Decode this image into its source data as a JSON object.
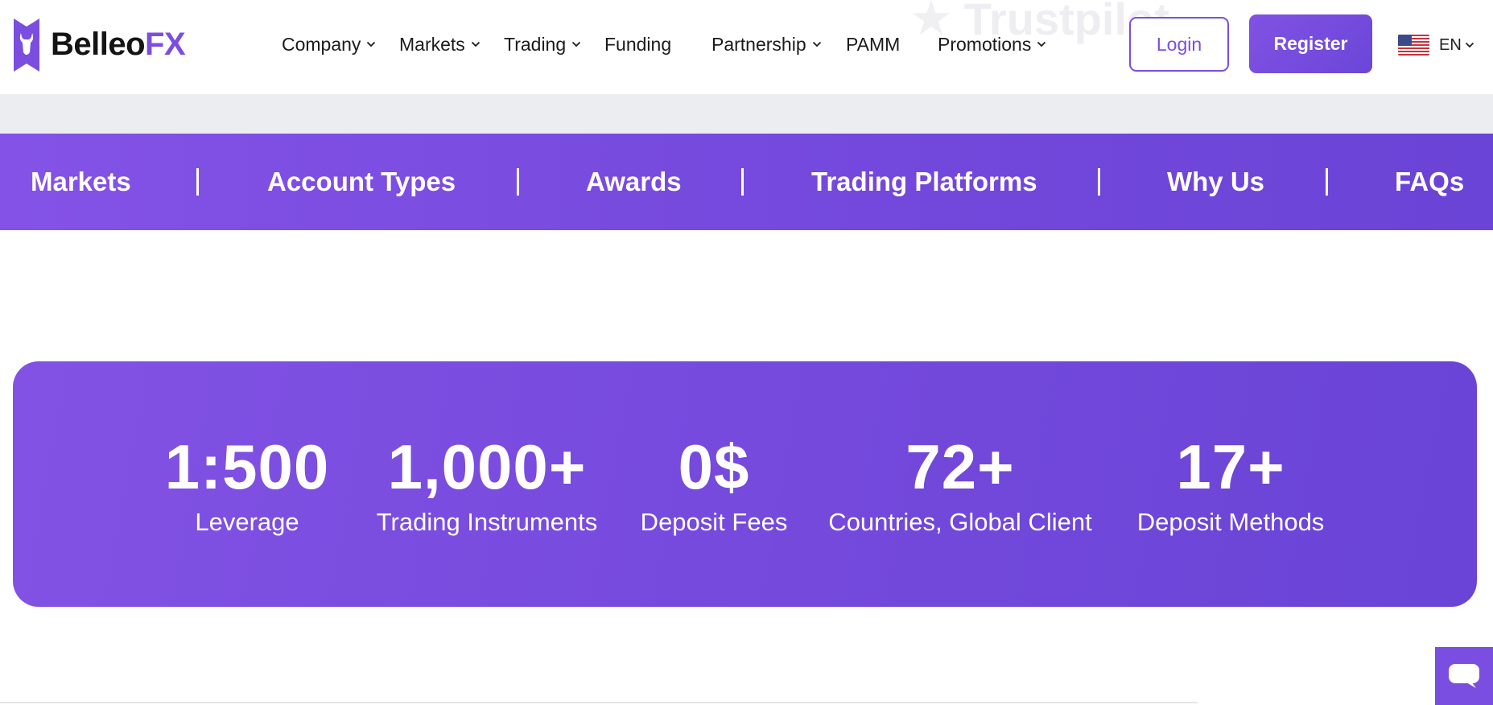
{
  "brand": {
    "name_main": "Belleo",
    "name_accent": "FX"
  },
  "nav": {
    "items": [
      {
        "label": "Company",
        "has_dropdown": true
      },
      {
        "label": "Markets",
        "has_dropdown": true
      },
      {
        "label": "Trading",
        "has_dropdown": true
      },
      {
        "label": "Funding",
        "has_dropdown": false
      },
      {
        "label": "Partnership",
        "has_dropdown": true
      },
      {
        "label": "PAMM",
        "has_dropdown": false
      },
      {
        "label": "Promotions",
        "has_dropdown": true
      }
    ]
  },
  "header": {
    "login_label": "Login",
    "register_label": "Register",
    "language": "EN",
    "language_icon": "us-flag-icon"
  },
  "subnav": {
    "items": [
      "Markets",
      "Account Types",
      "Awards",
      "Trading Platforms",
      "Why Us",
      "FAQs"
    ]
  },
  "stats": [
    {
      "value": "1:500",
      "label": "Leverage"
    },
    {
      "value": "1,000+",
      "label": "Trading Instruments"
    },
    {
      "value": "0$",
      "label": "Deposit Fees"
    },
    {
      "value": "72+",
      "label": "Countries, Global Client"
    },
    {
      "value": "17+",
      "label": "Deposit Methods"
    }
  ],
  "colors": {
    "accent": "#7b4ee0",
    "text": "#1b1b1b",
    "band": "#ecedf1"
  },
  "chat": {
    "icon": "chat-bubble-icon"
  }
}
